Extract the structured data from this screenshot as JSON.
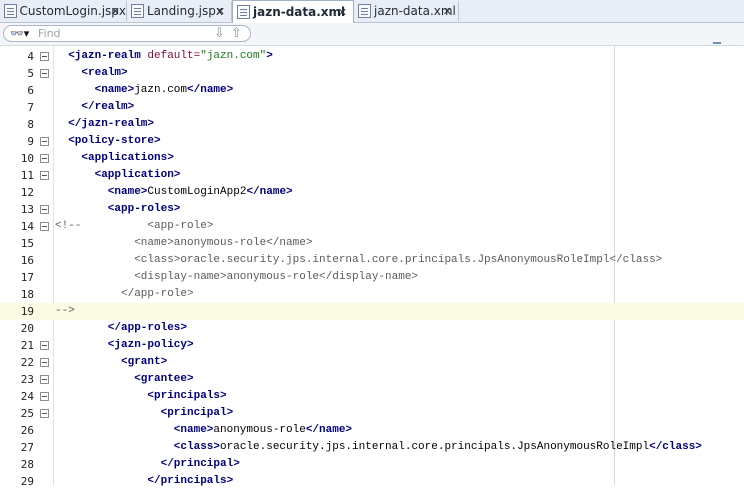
{
  "tabs": [
    {
      "label": "CustomLogin.jspx",
      "close": "✕",
      "active": false
    },
    {
      "label": "Landing.jspx",
      "close": "✕",
      "active": false
    },
    {
      "label": "jazn-data.xml",
      "close": "✕",
      "active": true
    },
    {
      "label": "jazn-data.xml",
      "close": "✕",
      "active": false
    }
  ],
  "find": {
    "placeholder": "Find",
    "icon": "binoculars-icon",
    "prev_icon": "arrow-down-icon",
    "next_icon": "arrow-up-icon"
  },
  "editor": {
    "lines": [
      {
        "num": "4",
        "fold": true,
        "indent": 2,
        "parts": [
          [
            "tag",
            "<jazn-realm "
          ],
          [
            "attr",
            "default="
          ],
          [
            "val",
            "\"jazn.com\""
          ],
          [
            "tag",
            ">"
          ]
        ]
      },
      {
        "num": "5",
        "fold": true,
        "indent": 4,
        "parts": [
          [
            "tag",
            "<realm>"
          ]
        ]
      },
      {
        "num": "6",
        "fold": false,
        "indent": 6,
        "parts": [
          [
            "tag",
            "<name>"
          ],
          [
            "txt",
            "jazn.com"
          ],
          [
            "tag",
            "</name>"
          ]
        ]
      },
      {
        "num": "7",
        "fold": false,
        "indent": 4,
        "parts": [
          [
            "tag",
            "</realm>"
          ]
        ]
      },
      {
        "num": "8",
        "fold": false,
        "indent": 2,
        "parts": [
          [
            "tag",
            "</jazn-realm>"
          ]
        ]
      },
      {
        "num": "9",
        "fold": true,
        "indent": 2,
        "parts": [
          [
            "tag",
            "<policy-store>"
          ]
        ]
      },
      {
        "num": "10",
        "fold": true,
        "indent": 4,
        "parts": [
          [
            "tag",
            "<applications>"
          ]
        ]
      },
      {
        "num": "11",
        "fold": true,
        "indent": 6,
        "parts": [
          [
            "tag",
            "<application>"
          ]
        ]
      },
      {
        "num": "12",
        "fold": false,
        "indent": 8,
        "parts": [
          [
            "tag",
            "<name>"
          ],
          [
            "txt",
            "CustomLoginApp2"
          ],
          [
            "tag",
            "</name>"
          ]
        ]
      },
      {
        "num": "13",
        "fold": true,
        "indent": 8,
        "parts": [
          [
            "tag",
            "<app-roles>"
          ]
        ]
      },
      {
        "num": "14",
        "fold": true,
        "indent": 0,
        "parts": [
          [
            "cmt",
            "<!--          <app-role>"
          ]
        ]
      },
      {
        "num": "15",
        "fold": false,
        "indent": 12,
        "parts": [
          [
            "cmt",
            "<name>anonymous-role</name>"
          ]
        ]
      },
      {
        "num": "16",
        "fold": false,
        "indent": 12,
        "parts": [
          [
            "cmt",
            "<class>oracle.security.jps.internal.core.principals.JpsAnonymousRoleImpl</class>"
          ]
        ]
      },
      {
        "num": "17",
        "fold": false,
        "indent": 12,
        "parts": [
          [
            "cmt",
            "<display-name>anonymous-role</display-name>"
          ]
        ]
      },
      {
        "num": "18",
        "fold": false,
        "indent": 10,
        "parts": [
          [
            "cmt",
            "</app-role>"
          ]
        ]
      },
      {
        "num": "19",
        "fold": false,
        "indent": 0,
        "highlight": true,
        "parts": [
          [
            "cmt",
            "-->"
          ]
        ]
      },
      {
        "num": "20",
        "fold": false,
        "indent": 8,
        "parts": [
          [
            "tag",
            "</app-roles>"
          ]
        ]
      },
      {
        "num": "21",
        "fold": true,
        "indent": 8,
        "parts": [
          [
            "tag",
            "<jazn-policy>"
          ]
        ]
      },
      {
        "num": "22",
        "fold": true,
        "indent": 10,
        "parts": [
          [
            "tag",
            "<grant>"
          ]
        ]
      },
      {
        "num": "23",
        "fold": true,
        "indent": 12,
        "parts": [
          [
            "tag",
            "<grantee>"
          ]
        ]
      },
      {
        "num": "24",
        "fold": true,
        "indent": 14,
        "parts": [
          [
            "tag",
            "<principals>"
          ]
        ]
      },
      {
        "num": "25",
        "fold": true,
        "indent": 16,
        "parts": [
          [
            "tag",
            "<principal>"
          ]
        ]
      },
      {
        "num": "26",
        "fold": false,
        "indent": 18,
        "parts": [
          [
            "tag",
            "<name>"
          ],
          [
            "txt",
            "anonymous-role"
          ],
          [
            "tag",
            "</name>"
          ]
        ]
      },
      {
        "num": "27",
        "fold": false,
        "indent": 18,
        "parts": [
          [
            "tag",
            "<class>"
          ],
          [
            "txt",
            "oracle.security.jps.internal.core.principals.JpsAnonymousRoleImpl"
          ],
          [
            "tag",
            "</class>"
          ]
        ]
      },
      {
        "num": "28",
        "fold": false,
        "indent": 16,
        "parts": [
          [
            "tag",
            "</principal>"
          ]
        ]
      },
      {
        "num": "29",
        "fold": false,
        "indent": 14,
        "parts": [
          [
            "tag",
            "</principals>"
          ]
        ]
      }
    ]
  }
}
